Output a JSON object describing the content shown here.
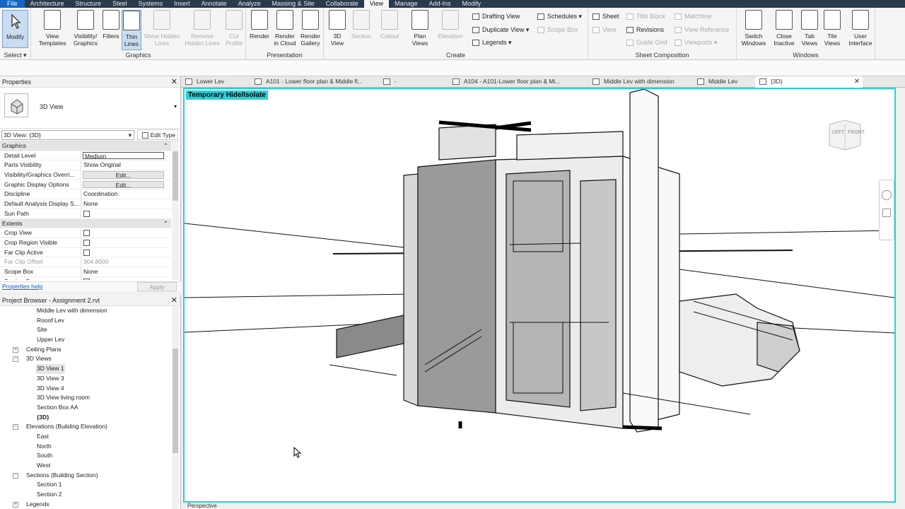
{
  "ribbon_tabs": [
    "File",
    "Architecture",
    "Structure",
    "Steel",
    "Systems",
    "Insert",
    "Annotate",
    "Analyze",
    "Massing & Site",
    "Collaborate",
    "View",
    "Manage",
    "Add-Ins",
    "Modify"
  ],
  "active_tab": "View",
  "ribbon": {
    "select": {
      "modify": "Modify",
      "title": "Select ▾"
    },
    "graphics": {
      "title": "Graphics",
      "view_templates": "View Templates",
      "visibility_graphics": "Visibility/ Graphics",
      "filters": "Filters",
      "thin_lines": "Thin Lines",
      "show_hidden_lines": "Show Hidden Lines",
      "remove_hidden_lines": "Remove Hidden Lines",
      "cut_profile": "Cut Profile"
    },
    "presentation": {
      "title": "Presentation",
      "render": "Render",
      "render_cloud": "Render in Cloud",
      "render_gallery": "Render Gallery"
    },
    "create": {
      "title": "Create",
      "view_3d": "3D View",
      "section": "Section",
      "callout": "Callout",
      "plan_views": "Plan Views",
      "elevation": "Elevation",
      "drafting_view": "Drafting View",
      "duplicate_view": "Duplicate View",
      "legends": "Legends",
      "schedules": "Schedules",
      "scope_box": "Scope Box"
    },
    "sheet_composition": {
      "title": "Sheet Composition",
      "sheet": "Sheet",
      "view": "View",
      "title_block": "Title Block",
      "revisions": "Revisions",
      "guide_grid": "Guide Grid",
      "matchline": "Matchline",
      "view_reference": "View Reference",
      "viewports": "Viewports"
    },
    "windows": {
      "title": "Windows",
      "switch_windows": "Switch Windows",
      "close_inactive": "Close Inactive",
      "tab_views": "Tab Views",
      "tile_views": "Tile Views",
      "user_interface": "User Interface"
    }
  },
  "properties": {
    "title": "Properties",
    "type_name": "3D View",
    "instance": "3D View: {3D}",
    "edit_type": "Edit Type",
    "groups": [
      {
        "name": "Graphics",
        "rows": [
          {
            "k": "Detail Level",
            "v": "Medium",
            "kind": "box"
          },
          {
            "k": "Parts Visibility",
            "v": "Show Original",
            "kind": "text"
          },
          {
            "k": "Visibility/Graphics Overri...",
            "v": "Edit...",
            "kind": "button"
          },
          {
            "k": "Graphic Display Options",
            "v": "Edit...",
            "kind": "button"
          },
          {
            "k": "Discipline",
            "v": "Coordination",
            "kind": "text"
          },
          {
            "k": "Default Analysis Display S...",
            "v": "None",
            "kind": "text"
          },
          {
            "k": "Sun Path",
            "v": "",
            "kind": "check"
          }
        ]
      },
      {
        "name": "Extents",
        "rows": [
          {
            "k": "Crop View",
            "v": "",
            "kind": "check"
          },
          {
            "k": "Crop Region Visible",
            "v": "",
            "kind": "check"
          },
          {
            "k": "Far Clip Active",
            "v": "",
            "kind": "check"
          },
          {
            "k": "Far Clip Offset",
            "v": "304.8000",
            "kind": "disabled"
          },
          {
            "k": "Scope Box",
            "v": "None",
            "kind": "text"
          },
          {
            "k": "Section Box",
            "v": "",
            "kind": "check"
          }
        ]
      }
    ],
    "help": "Properties help",
    "apply": "Apply"
  },
  "browser": {
    "title": "Project Browser - Assignment 2.rvt",
    "items": [
      {
        "label": "Middle Lev with dimension",
        "level": 2
      },
      {
        "label": "Rooof Lev",
        "level": 2
      },
      {
        "label": "Site",
        "level": 2
      },
      {
        "label": "Upper Lev",
        "level": 2
      },
      {
        "label": "Ceiling Plans",
        "level": 1,
        "exp": "+"
      },
      {
        "label": "3D Views",
        "level": 1,
        "exp": "-"
      },
      {
        "label": "3D View 1",
        "level": 2,
        "hl": true
      },
      {
        "label": "3D View 3",
        "level": 2
      },
      {
        "label": "3D View 4",
        "level": 2
      },
      {
        "label": "3D View living room",
        "level": 2
      },
      {
        "label": "Section Box AA",
        "level": 2
      },
      {
        "label": "{3D}",
        "level": 2,
        "cur": true
      },
      {
        "label": "Elevations (Building Elevation)",
        "level": 1,
        "exp": "-"
      },
      {
        "label": "East",
        "level": 2
      },
      {
        "label": "North",
        "level": 2
      },
      {
        "label": "South",
        "level": 2
      },
      {
        "label": "West",
        "level": 2
      },
      {
        "label": "Sections (Building Section)",
        "level": 1,
        "exp": "-"
      },
      {
        "label": "Section 1",
        "level": 2
      },
      {
        "label": "Section 2",
        "level": 2
      },
      {
        "label": "Legends",
        "level": 1,
        "exp": "+"
      }
    ]
  },
  "doc_tabs": [
    {
      "label": "Lower Lev"
    },
    {
      "label": "A101 - Lower floor plan & Middle fl..."
    },
    {
      "label": "-"
    },
    {
      "label": "A104 - A101-Lower floor plan & Mi..."
    },
    {
      "label": "Middle Lev with dimension"
    },
    {
      "label": "Middle Lev"
    },
    {
      "label": "{3D}",
      "active": true
    }
  ],
  "viewport": {
    "badge": "Temporary Hide/Isolate",
    "cube_left": "LEFT",
    "cube_front": "FRONT",
    "status": "Perspective"
  },
  "colors": {
    "accent": "#26d1d9",
    "file_tab": "#1565c0",
    "tab_bar": "#2b3a4a"
  }
}
